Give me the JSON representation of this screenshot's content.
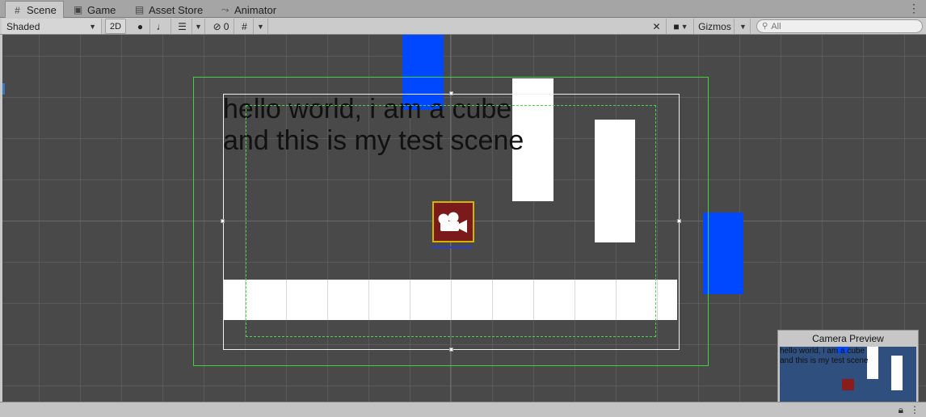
{
  "tabs": [
    {
      "label": "Scene",
      "icon": "grid-icon",
      "glyph": "#"
    },
    {
      "label": "Game",
      "icon": "gamepad-icon",
      "glyph": "▣"
    },
    {
      "label": "Asset Store",
      "icon": "bag-icon",
      "glyph": "▤"
    },
    {
      "label": "Animator",
      "icon": "animator-icon",
      "glyph": "⤳"
    }
  ],
  "toolbar": {
    "draw_mode": "Shaded",
    "mode_2d": "2D",
    "hidden_count": "0",
    "gizmos": "Gizmos",
    "search_placeholder": "All"
  },
  "scene": {
    "text_line_1": "hello world, i am a cube",
    "text_line_2": "and this is my test scene"
  },
  "camera_preview": {
    "title": "Camera Preview"
  },
  "colors": {
    "viewport_bg": "#494949",
    "preview_bg": "#2f4f7f",
    "blue_block": "#0048ff",
    "camera_gizmo": "#7a1a1a",
    "camera_outline": "#d5b400",
    "bounds_green": "#39d739"
  }
}
